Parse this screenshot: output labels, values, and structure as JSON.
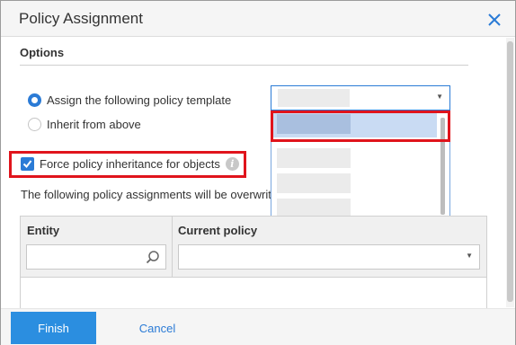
{
  "dialog": {
    "title": "Policy Assignment",
    "close_icon": "close-icon"
  },
  "options": {
    "header": "Options",
    "radio_assign_label": "Assign the following policy template",
    "radio_assign_checked": true,
    "radio_inherit_label": "Inherit from above",
    "radio_inherit_checked": false,
    "template_select": {
      "selected_value": "",
      "options_count_visible": 4,
      "highlighted_index": 0
    },
    "force_inheritance_label": "Force policy inheritance for objects",
    "force_inheritance_checked": true,
    "info_icon": "info-icon",
    "note": "The following policy assignments will be overwrit"
  },
  "grid": {
    "columns": [
      {
        "title": "Entity",
        "filter_value": "",
        "filter_icon": "search-icon"
      },
      {
        "title": "Current policy",
        "filter_value": ""
      }
    ]
  },
  "footer": {
    "finish_label": "Finish",
    "cancel_label": "Cancel"
  },
  "colors": {
    "accent": "#2b7bd6",
    "primary_button": "#2b8ee0",
    "highlight_box": "#e0141c",
    "selected_option": "#c9dbf3"
  }
}
